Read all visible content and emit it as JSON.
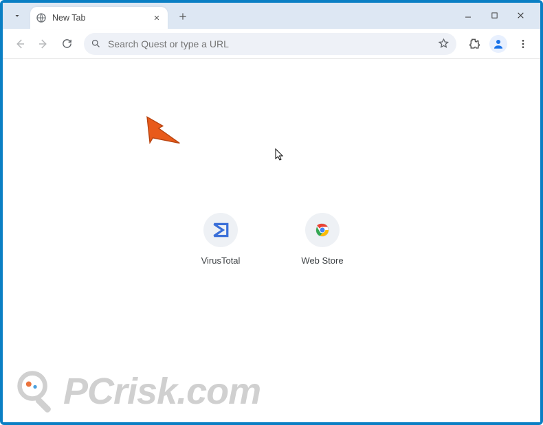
{
  "tab": {
    "title": "New Tab"
  },
  "omnibox": {
    "placeholder": "Search Quest or type a URL"
  },
  "shortcuts": [
    {
      "label": "VirusTotal"
    },
    {
      "label": "Web Store"
    }
  ],
  "watermark": {
    "text": "PCrisk.com"
  }
}
